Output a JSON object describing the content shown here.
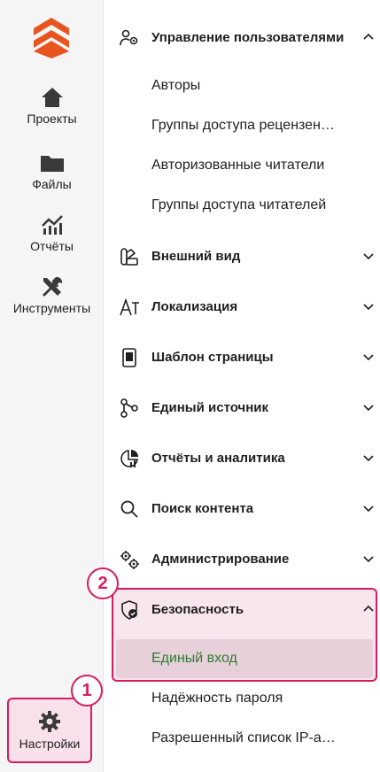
{
  "rail": {
    "items": [
      {
        "label": "Проекты",
        "icon": "home-icon"
      },
      {
        "label": "Файлы",
        "icon": "folder-icon"
      },
      {
        "label": "Отчёты",
        "icon": "chart-icon"
      },
      {
        "label": "Инструменты",
        "icon": "tools-icon"
      }
    ],
    "settings_label": "Настройки",
    "settings_icon": "gear-icon"
  },
  "badges": {
    "one": "1",
    "two": "2"
  },
  "menu": {
    "users": {
      "label": "Управление пользователями",
      "items": [
        "Авторы",
        "Группы доступа рецензен…",
        "Авторизованные читатели",
        "Группы доступа читателей"
      ]
    },
    "appearance": "Внешний вид",
    "localization": "Локализация",
    "template": "Шаблон страницы",
    "single_source": "Единый источник",
    "reports": "Отчёты и аналитика",
    "search": "Поиск контента",
    "admin": "Администрирование",
    "security": {
      "label": "Безопасность",
      "items": [
        "Единый вход",
        "Надёжность пароля",
        "Разрешенный список IP-а…"
      ]
    }
  },
  "colors": {
    "accent": "#d81b60",
    "active_text": "#2e7d32",
    "logo": "#e8541e"
  }
}
